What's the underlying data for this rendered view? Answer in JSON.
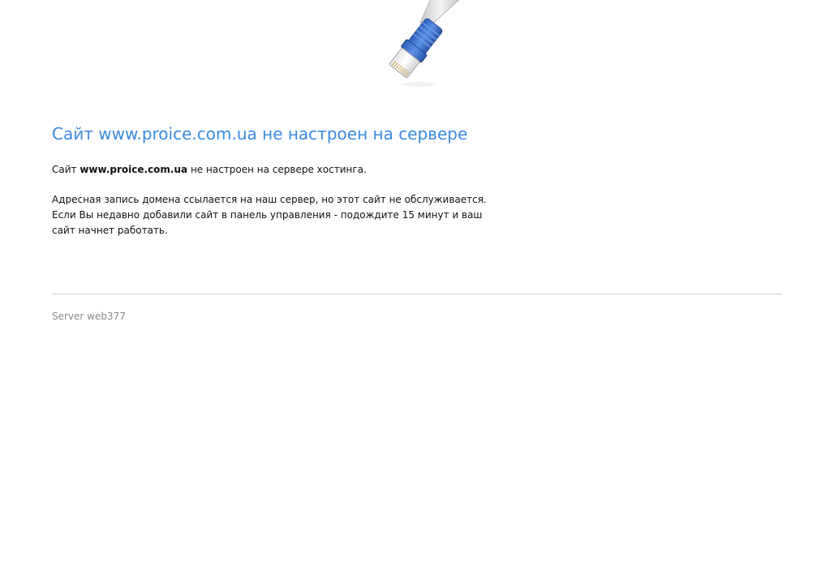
{
  "heading": "Сайт www.proice.com.ua не настроен на сервере",
  "intro": {
    "prefix": "Сайт ",
    "domain": "www.proice.com.ua",
    "suffix": " не настроен на сервере хостинга."
  },
  "details": {
    "line1": "Адресная запись домена ссылается на наш сервер, но этот сайт не обслуживается.",
    "line2": "Если Вы недавно добавили сайт в панель управления - подождите 15 минут и ваш сайт начнет работать."
  },
  "footer": {
    "server": "Server web377"
  },
  "icons": {
    "cable": "network-cable-icon"
  },
  "colors": {
    "heading": "#3a8ae0",
    "connector": "#3b6fd0",
    "footer_text": "#8a8a8a",
    "divider": "#cfcfcf"
  }
}
